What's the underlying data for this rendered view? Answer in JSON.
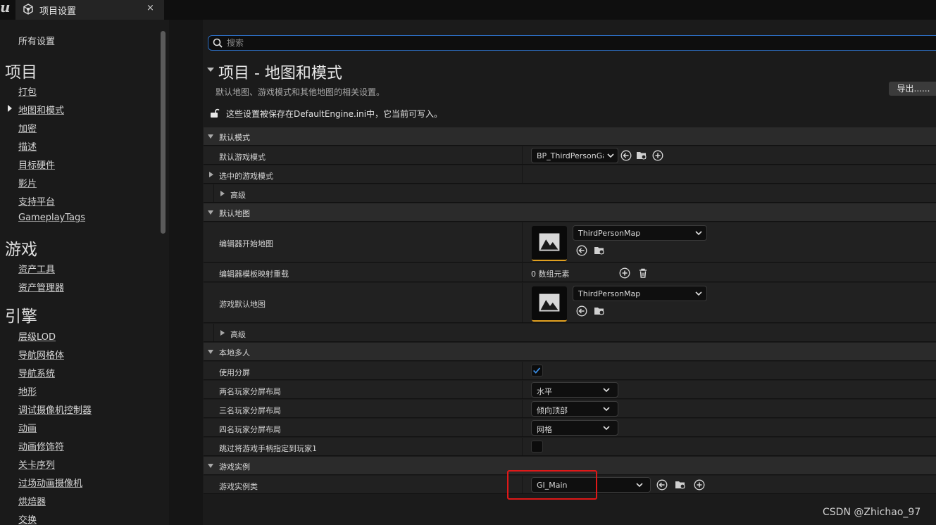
{
  "tab": {
    "title": "项目设置",
    "close": "×"
  },
  "sidebar": {
    "all_settings": "所有设置",
    "sections": [
      {
        "heading": "项目",
        "items": [
          "打包",
          "地图和模式",
          "加密",
          "描述",
          "目标硬件",
          "影片",
          "支持平台",
          "GameplayTags"
        ]
      },
      {
        "heading": "游戏",
        "items": [
          "资产工具",
          "资产管理器"
        ]
      },
      {
        "heading": "引擎",
        "items": [
          "层级LOD",
          "导航网格体",
          "导航系统",
          "地形",
          "调试摄像机控制器",
          "动画",
          "动画修饰符",
          "关卡序列",
          "过场动画摄像机",
          "烘焙器",
          "交换"
        ]
      }
    ],
    "selected_item": "地图和模式"
  },
  "search": {
    "placeholder": "搜索",
    "value": ""
  },
  "page": {
    "title": "项目 - 地图和模式",
    "description": "默认地图、游戏模式和其他地图的相关设置。",
    "export_label": "导出......",
    "save_note": "这些设置被保存在DefaultEngine.ini中，它当前可写入。"
  },
  "sections": {
    "default_modes": {
      "label": "默认模式",
      "default_game_mode": {
        "label": "默认游戏模式",
        "value": "BP_ThirdPersonGameMode"
      },
      "selected_game_mode": {
        "label": "选中的游戏模式"
      },
      "advanced": {
        "label": "高级"
      }
    },
    "default_maps": {
      "label": "默认地图",
      "editor_startup_map": {
        "label": "编辑器开始地图",
        "value": "ThirdPersonMap"
      },
      "editor_template_overrides": {
        "label": "编辑器模板映射重载",
        "count_text": "0 数组元素"
      },
      "game_default_map": {
        "label": "游戏默认地图",
        "value": "ThirdPersonMap"
      },
      "advanced": {
        "label": "高级"
      }
    },
    "local_multiplayer": {
      "label": "本地多人",
      "use_splitscreen": {
        "label": "使用分屏",
        "checked": true
      },
      "two_player_layout": {
        "label": "两名玩家分屏布局",
        "value": "水平"
      },
      "three_player_layout": {
        "label": "三名玩家分屏布局",
        "value": "倾向顶部"
      },
      "four_player_layout": {
        "label": "四名玩家分屏布局",
        "value": "网格"
      },
      "skip_gamepad": {
        "label": "跳过将游戏手柄指定到玩家1",
        "checked": false
      }
    },
    "game_instance": {
      "label": "游戏实例",
      "game_instance_class": {
        "label": "游戏实例类",
        "value": "GI_Main"
      }
    }
  },
  "colors": {
    "accent": "#2d6fc4",
    "highlight": "#e01818",
    "thumb_accent": "#e0a020",
    "checkbox_check": "#3a8ee6"
  },
  "watermark": "CSDN @Zhichao_97"
}
